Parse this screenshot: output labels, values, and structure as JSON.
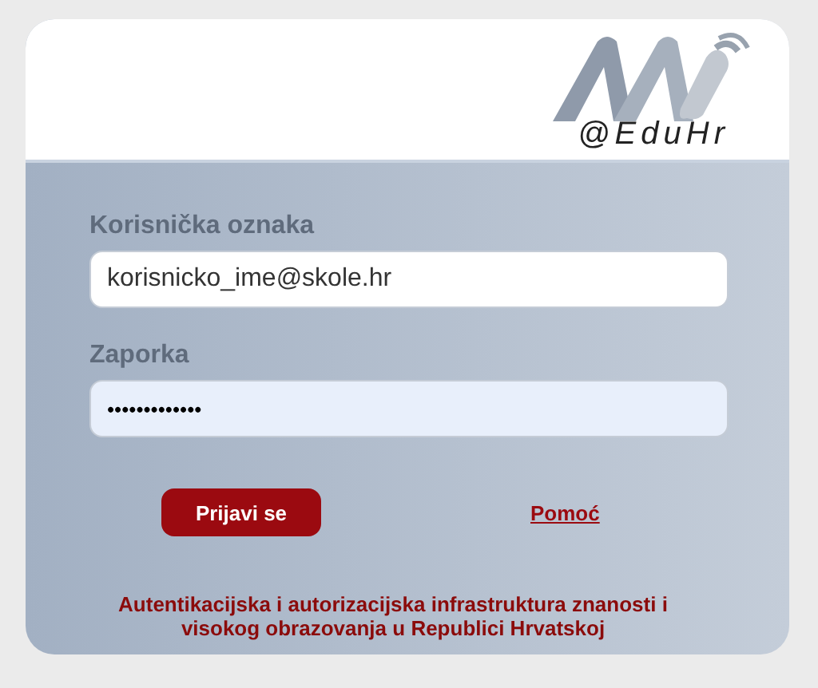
{
  "logo": {
    "tagline": "@EduHr"
  },
  "fields": [
    {
      "label": "Korisnička oznaka",
      "value": "korisnicko_ime@skole.hr",
      "kind": "text"
    },
    {
      "label": "Zaporka",
      "value": "•••••••••••••",
      "kind": "password"
    }
  ],
  "login_button": "Prijavi se",
  "help_link": "Pomoć",
  "footer": "Autentikacijska i autorizacijska infrastruktura znanosti i visokog obrazovanja u Republici Hrvatskoj"
}
